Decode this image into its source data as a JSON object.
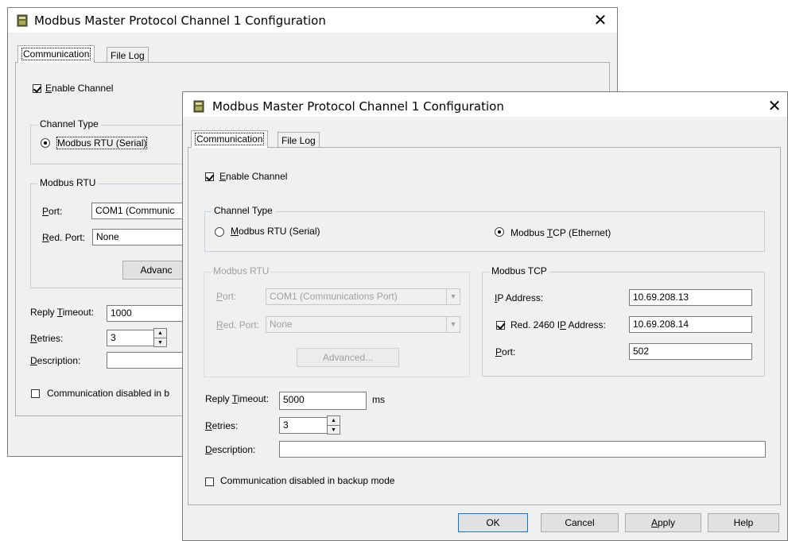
{
  "back_dialog": {
    "title": "Modbus Master Protocol Channel 1 Configuration",
    "close_glyph": "✕",
    "tabs": [
      "Communication",
      "File Log"
    ],
    "enable_channel": {
      "pre": "",
      "ul": "E",
      "post": "nable Channel",
      "checked": true
    },
    "channel_type": {
      "legend": "Channel Type",
      "rtu_label": "Modbus RTU (Serial)"
    },
    "modbus_rtu": {
      "legend": "Modbus RTU",
      "port_label": {
        "ul": "P",
        "post": "ort:"
      },
      "port_value": "COM1 (Communic",
      "red_port_label": {
        "ul": "R",
        "post": "ed. Port:"
      },
      "red_port_value": "None",
      "advanced": "Advanc"
    },
    "reply_timeout": {
      "pre": "Reply ",
      "ul": "T",
      "post": "imeout:",
      "value": "1000"
    },
    "retries": {
      "ul": "R",
      "post": "etries:",
      "value": "3"
    },
    "description": {
      "ul": "D",
      "post": "escription:",
      "value": ""
    },
    "comm_disabled": "Communication disabled in b"
  },
  "front_dialog": {
    "title": "Modbus Master Protocol Channel 1 Configuration",
    "close_glyph": "✕",
    "tabs": [
      "Communication",
      "File Log"
    ],
    "enable_channel": {
      "ul": "E",
      "post": "nable Channel",
      "checked": true
    },
    "channel_type": {
      "legend": "Channel Type",
      "rtu": {
        "ul": "M",
        "post": "odbus RTU (Serial)",
        "selected": false
      },
      "tcp": {
        "pre": "Modbus ",
        "ul": "T",
        "post": "CP (Ethernet)",
        "selected": true
      }
    },
    "modbus_rtu": {
      "legend": "Modbus RTU",
      "port_label": {
        "ul": "P",
        "post": "ort:"
      },
      "port_value": "COM1 (Communications Port)",
      "red_port_label": {
        "ul": "R",
        "post": "ed. Port:"
      },
      "red_port_value": "None",
      "advanced": "Advanced..."
    },
    "modbus_tcp": {
      "legend": "Modbus TCP",
      "ip_label": {
        "ul": "I",
        "post": "P Address:"
      },
      "ip_value": "10.69.208.13",
      "red_ip_label": {
        "pre": "Red. 2460 I",
        "ul": "P",
        "post": " Address:"
      },
      "red_ip_checked": true,
      "red_ip_value": "10.69.208.14",
      "port_label": {
        "ul": "P",
        "post": "ort:"
      },
      "port_value": "502"
    },
    "reply_timeout": {
      "pre": "Reply ",
      "ul": "T",
      "post": "imeout:",
      "value": "5000",
      "unit": "ms"
    },
    "retries": {
      "ul": "R",
      "post": "etries:",
      "value": "3"
    },
    "description": {
      "ul": "D",
      "post": "escription:",
      "value": ""
    },
    "comm_disabled": {
      "label": "Communication disabled in backup mode",
      "checked": false
    },
    "buttons": {
      "ok": "OK",
      "cancel": "Cancel",
      "apply_ul": "A",
      "apply_post": "pply",
      "help": "Help"
    }
  },
  "spin_glyphs": {
    "up": "▲",
    "down": "▼"
  },
  "combo_glyph": "▼"
}
